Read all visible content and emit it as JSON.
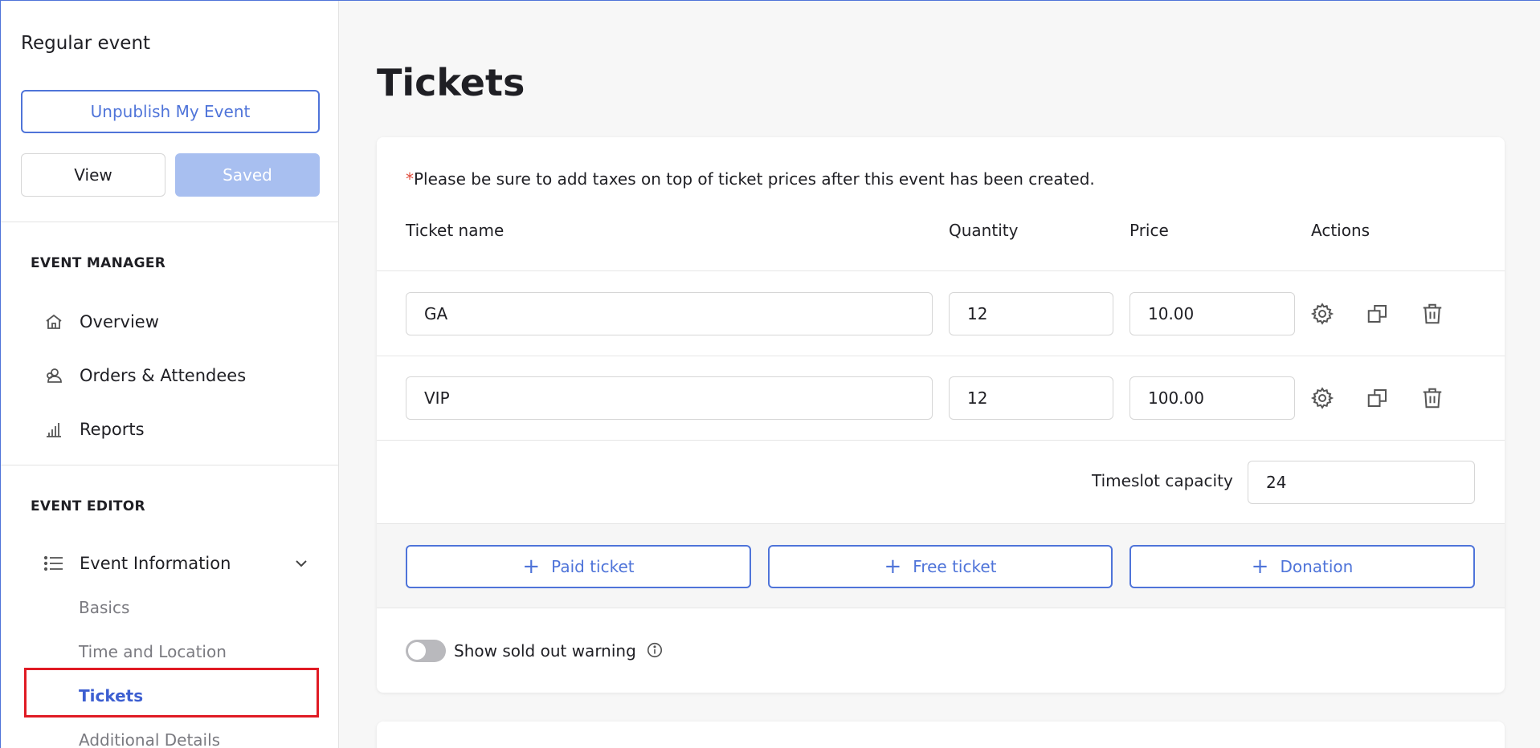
{
  "sidebar": {
    "event_title": "Regular event",
    "unpublish_label": "Unpublish My Event",
    "view_label": "View",
    "saved_label": "Saved",
    "event_manager": {
      "heading": "EVENT MANAGER",
      "items": [
        {
          "label": "Overview",
          "icon": "home-icon"
        },
        {
          "label": "Orders & Attendees",
          "icon": "attendees-icon"
        },
        {
          "label": "Reports",
          "icon": "bar-chart-icon"
        }
      ]
    },
    "event_editor": {
      "heading": "EVENT EDITOR",
      "group_label": "Event Information",
      "group_icon": "list-icon",
      "sub_items": [
        {
          "label": "Basics"
        },
        {
          "label": "Time and Location"
        },
        {
          "label": "Tickets",
          "active": true
        },
        {
          "label": "Additional Details"
        }
      ]
    }
  },
  "main": {
    "page_title": "Tickets",
    "notice_star": "*",
    "notice_text": "Please be sure to add taxes on top of ticket prices after this event has been created.",
    "columns": {
      "name": "Ticket name",
      "quantity": "Quantity",
      "price": "Price",
      "actions": "Actions"
    },
    "tickets": [
      {
        "name": "GA",
        "quantity": "12",
        "price": "10.00"
      },
      {
        "name": "VIP",
        "quantity": "12",
        "price": "100.00"
      }
    ],
    "timeslot_label": "Timeslot capacity",
    "timeslot_value": "24",
    "add_buttons": {
      "paid": "Paid ticket",
      "free": "Free ticket",
      "donation": "Donation"
    },
    "sold_out_label": "Show sold out warning",
    "sold_out_enabled": false
  },
  "colors": {
    "accent": "#4f74d9",
    "active_nav": "#3d5fd1",
    "highlight": "#e01b24",
    "saved_bg": "#a8bff0"
  }
}
